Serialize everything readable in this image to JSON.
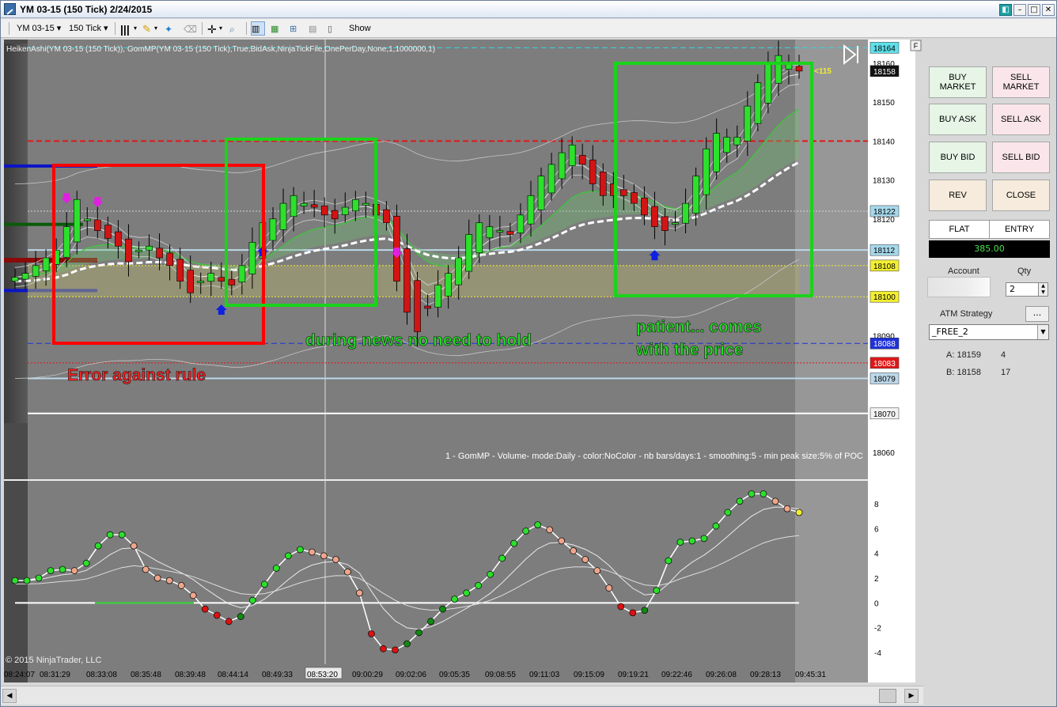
{
  "window": {
    "title": "YM 03-15 (150 Tick)  2/24/2015",
    "icons": [
      "chart-app-icon",
      "restore-icon",
      "minimize-icon",
      "maximize-icon",
      "close-icon"
    ]
  },
  "toolbar": {
    "instrument": "YM 03-15",
    "interval": "150 Tick",
    "show_label": "Show",
    "icons": [
      "bar-type-icon",
      "pencil-icon",
      "wand-icon",
      "eraser-icon",
      "crosshair-icon",
      "zoom-icon",
      "bar-chart-icon",
      "candles-icon",
      "line-chart-icon",
      "data-box-icon",
      "text-icon"
    ]
  },
  "chart_header": {
    "indicator_text": "HeikenAshi(YM 03-15 (150 Tick)), GomMP(YM 03-15 (150 Tick),True,BidAsk,NinjaTickFile,OnePerDay,None,1,1000000,1)",
    "gommp_text": "1 - GomMP - Volume- mode:Daily  - color:NoColor - nb bars/days:1 - smoothing:5 - min peak size:5% of POC",
    "copyright": "© 2015 NinjaTrader, LLC",
    "panel_box_letter": "F",
    "offset_label": "<115"
  },
  "annotations": {
    "error_text": "Error against rule",
    "news_text": "during news no need to hold",
    "patient_line1": "patient... comes",
    "patient_line2": "with the price",
    "colors": {
      "red_box": "#ff0000",
      "green_box": "#1bd31b",
      "text_green": "#22e022",
      "text_red": "#ff2222"
    }
  },
  "chart_data": [
    {
      "type": "candlestick",
      "series_name": "Heiken Ashi YM 03-15 (150 Tick)",
      "y_tick_labels": [
        18060,
        18070,
        18090,
        18100,
        18120,
        18130,
        18140,
        18150,
        18160
      ],
      "ylim": [
        18053,
        18166
      ],
      "price_markers": [
        {
          "value": "18164",
          "color": "#5ee0ea"
        },
        {
          "value": "18158",
          "color": "#111111"
        },
        {
          "value": "18122",
          "color": "#a6d8ea"
        },
        {
          "value": "18112",
          "color": "#a6d8ea"
        },
        {
          "value": "18108",
          "color": "#f2ee31"
        },
        {
          "value": "18100",
          "color": "#f2ee31"
        },
        {
          "value": "18088",
          "color": "#1f31d8"
        },
        {
          "value": "18083",
          "color": "#e01818"
        },
        {
          "value": "18079",
          "color": "#bcd8ea"
        },
        {
          "value": "18070",
          "color": "#f2f2f2"
        }
      ],
      "horizontal_levels": [
        {
          "value": 18164,
          "color": "#33d6e0",
          "style": "dash"
        },
        {
          "value": 18140,
          "color": "#e01818",
          "style": "dash"
        },
        {
          "value": 18122,
          "color": "#cfd8e0",
          "style": "dot"
        },
        {
          "value": 18112,
          "color": "#bcd8ea",
          "style": "solid"
        },
        {
          "value": 18108,
          "color": "#f2ee31",
          "style": "dot"
        },
        {
          "value": 18100,
          "color": "#f2ee31",
          "style": "dot"
        },
        {
          "value": 18088,
          "color": "#1f31d8",
          "style": "dash"
        },
        {
          "value": 18083,
          "color": "#e01818",
          "style": "dot"
        },
        {
          "value": 18079,
          "color": "#bcd8ea",
          "style": "solid"
        },
        {
          "value": 18070,
          "color": "#ffffff",
          "style": "solid"
        }
      ],
      "x_tick_labels": [
        "08:24:07",
        "08:31:29",
        "08:33:08",
        "08:35:48",
        "08:39:48",
        "08:44:14",
        "08:49:33",
        "08:53:20",
        "09:00:29",
        "09:02:06",
        "09:05:35",
        "09:08:55",
        "09:11:03",
        "09:15:09",
        "09:19:21",
        "09:22:46",
        "09:26:08",
        "09:28:13",
        "09:45:31"
      ],
      "close_path": [
        18105,
        18106,
        18108,
        18110,
        18112,
        18118,
        18125,
        18120,
        18117,
        18115,
        18113,
        18109,
        18112,
        18113,
        18110,
        18108,
        18104,
        18101,
        18104,
        18106,
        18104,
        18103,
        18108,
        18114,
        18119,
        18120,
        18124,
        18126,
        18124,
        18123,
        18121,
        18120,
        18123,
        18125,
        18124,
        18121,
        18119,
        18104,
        18096,
        18091,
        18097,
        18103,
        18106,
        18110,
        18116,
        18119,
        18118,
        18117,
        18116,
        18121,
        18126,
        18131,
        18134,
        18137,
        18139,
        18134,
        18129,
        18126,
        18126,
        18126,
        18124,
        18121,
        18118,
        18117,
        18119,
        18124,
        18131,
        18138,
        18142,
        18141,
        18141,
        18149,
        18155,
        18160,
        18162,
        18160,
        18158
      ]
    },
    {
      "type": "line-dots",
      "series_name": "oscillator",
      "y_tick_labels": [
        8,
        6,
        4,
        2,
        0,
        -2,
        -4
      ],
      "ylim": [
        -4.6,
        9.2
      ],
      "zero_level": 0,
      "values": [
        1.8,
        1.8,
        2.0,
        2.6,
        2.7,
        2.6,
        3.2,
        4.6,
        5.5,
        5.5,
        4.6,
        2.7,
        2.0,
        1.8,
        1.4,
        0.6,
        -0.5,
        -1.0,
        -1.5,
        -1.1,
        0.2,
        1.5,
        2.8,
        3.8,
        4.3,
        4.1,
        3.8,
        3.5,
        2.5,
        0.8,
        -2.5,
        -3.7,
        -3.8,
        -3.3,
        -2.4,
        -1.5,
        -0.5,
        0.3,
        0.8,
        1.4,
        2.3,
        3.6,
        4.8,
        5.8,
        6.3,
        5.9,
        5.0,
        4.2,
        3.5,
        2.6,
        1.2,
        -0.3,
        -0.8,
        -0.6,
        1.0,
        3.4,
        4.9,
        5.0,
        5.2,
        6.2,
        7.3,
        8.2,
        8.8,
        8.8,
        8.2,
        7.6,
        7.3
      ]
    }
  ],
  "right_axis": {
    "bottom_panel_labels": [
      "8",
      "6",
      "4",
      "2",
      "0",
      "-2",
      "-4"
    ]
  },
  "order_panel": {
    "buy_market": [
      "BUY",
      "MARKET"
    ],
    "sell_market": [
      "SELL",
      "MARKET"
    ],
    "buy_ask": "BUY ASK",
    "sell_ask": "SELL ASK",
    "buy_bid": "BUY BID",
    "sell_bid": "SELL BID",
    "rev": "REV",
    "close": "CLOSE",
    "position": "FLAT",
    "entry_label": "ENTRY",
    "entry_value": "385.00",
    "account_label": "Account",
    "qty_label": "Qty",
    "qty_value": "2",
    "atm_label": "ATM Strategy",
    "atm_button": "...",
    "atm_value": "_FREE_2",
    "ask_label": "A: 18159",
    "ask_size": "4",
    "bid_label": "B: 18158",
    "bid_size": "17"
  }
}
